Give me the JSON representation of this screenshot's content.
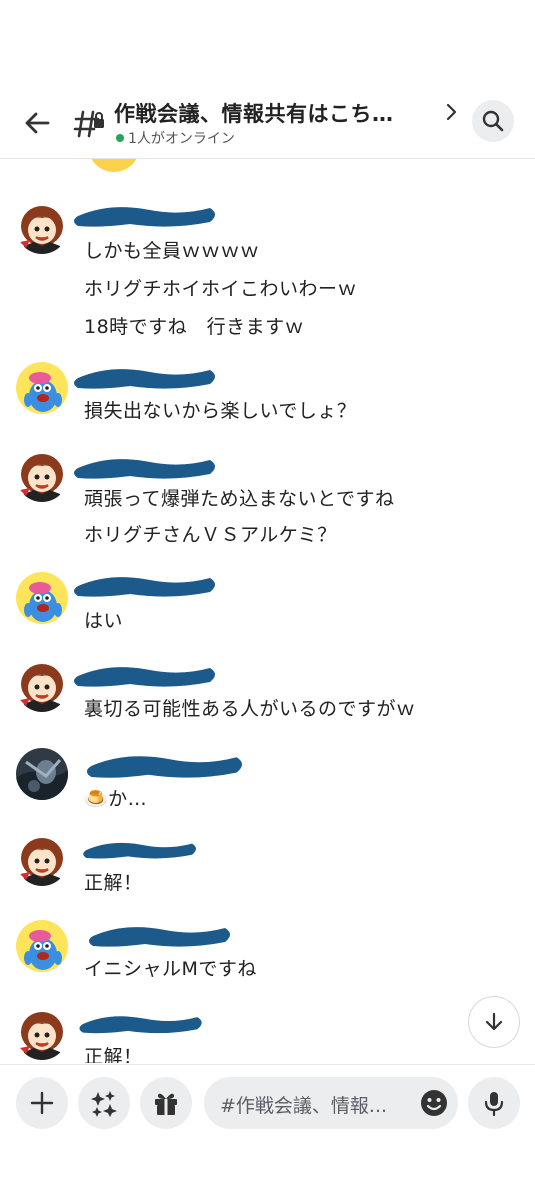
{
  "header": {
    "title": "作戦会議、情報共有はこち…",
    "online_status": "1人がオンライン"
  },
  "messages": [
    {
      "avatar": "girl-avatar",
      "lines": [
        "しかも全員ｗｗｗｗ",
        "ホリグチホイホイこわいわーｗ",
        "18時ですね　行きますｗ"
      ]
    },
    {
      "avatar": "blue-creature-avatar",
      "lines": [
        "損失出ないから楽しいでしょ？"
      ]
    },
    {
      "avatar": "girl-avatar",
      "lines": [
        "頑張って爆弾ため込まないとですね",
        "ホリグチさんＶＳアルケミ？"
      ]
    },
    {
      "avatar": "blue-creature-avatar",
      "lines": [
        "はい"
      ]
    },
    {
      "avatar": "girl-avatar",
      "lines": [
        "裏切る可能性ある人がいるのですがｗ"
      ]
    },
    {
      "avatar": "dark-photo-avatar",
      "lines": [
        "🍮か…"
      ]
    },
    {
      "avatar": "girl-avatar",
      "lines": [
        "正解！"
      ]
    },
    {
      "avatar": "blue-creature-avatar",
      "lines": [
        "イニシャルMですね"
      ]
    },
    {
      "avatar": "girl-avatar",
      "lines": [
        "正解！"
      ]
    }
  ],
  "composer": {
    "placeholder": "#作戦会議、情報..."
  },
  "colors": {
    "online": "#23a55a",
    "redaction": "#1c5a8c",
    "button_bg": "#ebedef"
  },
  "icons": [
    "back-arrow-icon",
    "channel-hash-lock-icon",
    "chevron-right-icon",
    "search-icon",
    "scroll-down-arrow-icon",
    "plus-icon",
    "apps-icon",
    "gift-icon",
    "emoji-icon",
    "microphone-icon"
  ]
}
